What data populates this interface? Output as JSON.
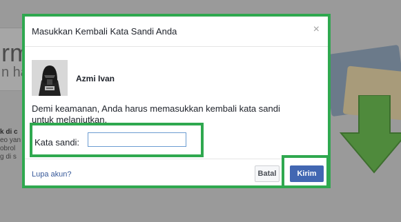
{
  "background": {
    "heading_fragment": "rma",
    "sub_fragment": "n ha",
    "side_lines": [
      "k di c",
      "eo yan",
      "obrol",
      "g di s"
    ]
  },
  "dialog": {
    "title": "Masukkan Kembali Kata Sandi Anda",
    "close_symbol": "×",
    "user_name": "Azmi Ivan",
    "message": "Demi keamanan, Anda harus memasukkan kembali kata sandi untuk melanjutkan.",
    "password_label": "Kata sandi:",
    "password_value": "",
    "forgot_link": "Lupa akun?",
    "cancel_label": "Batal",
    "submit_label": "Kirim"
  },
  "colors": {
    "highlight_border": "#2fa84f",
    "primary_button": "#4267b2",
    "link": "#365899"
  }
}
